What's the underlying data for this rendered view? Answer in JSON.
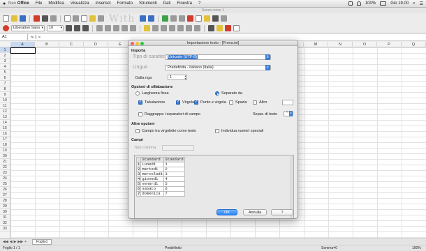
{
  "menubar": {
    "app_brand": "Office",
    "app_prefix": "Neo",
    "items": [
      "File",
      "Modifica",
      "Visualizza",
      "Inserisci",
      "Formato",
      "Strumenti",
      "Dati",
      "Finestra",
      "?"
    ],
    "clock": "Gio 19.00",
    "battery": "100%"
  },
  "window": {
    "title": "Senza nome 1"
  },
  "toolbar": {
    "watermark": "With",
    "font_name": "Liberation Sans",
    "font_size": "10"
  },
  "formula_bar": {
    "cell_ref": "A1",
    "fx_label": "fx  Σ  ="
  },
  "sheet": {
    "columns": [
      "A",
      "B",
      "C",
      "D",
      "E",
      "F",
      "G",
      "H",
      "I",
      "J",
      "K",
      "L",
      "M",
      "N",
      "O",
      "P",
      "Q"
    ],
    "rows": [
      "1",
      "2",
      "3",
      "4",
      "5",
      "6",
      "7",
      "8",
      "9",
      "10",
      "11",
      "12",
      "13",
      "14",
      "15",
      "16",
      "17",
      "18",
      "19",
      "20",
      "21",
      "22",
      "23",
      "24",
      "25",
      "26",
      "27",
      "28",
      "29",
      "30",
      "31",
      "32",
      "33"
    ],
    "tab_name": "Foglio1",
    "status": {
      "sheet": "Foglio 1 / 1",
      "style": "Predefinito",
      "sum": "Somma=0",
      "zoom": "100%"
    }
  },
  "dialog": {
    "title": "Importazione testo - [Prova.txt]",
    "import_section": "Importa",
    "charset_label": "Tipo di carattere",
    "charset_value": "Unicode (UTF-8)",
    "language_label": "Lingua",
    "language_value": "Predefinita - Italiano (Italia)",
    "from_row_label": "Dalla riga",
    "from_row_value": "1",
    "separator_section": "Opzioni di sillabazione",
    "fixed_width": "Larghezza fissa",
    "separated_by": "Separato da",
    "tab": "Tabulazione",
    "comma": "Virgola",
    "semicolon": "Punto e virgola",
    "space": "Spazio",
    "other": "Altro",
    "merge_delimiters": "Raggruppa i separatori di campo",
    "text_delimiter_label": "Separ. di testo",
    "text_delimiter_value": "\"",
    "other_section": "Altre opzioni",
    "quoted_as_text": "Campo tra virgolette come testo",
    "detect_special": "Individua numeri speciali",
    "fields_section": "Campi",
    "column_type_label": "Tipo colonna",
    "preview_headers": [
      "Standard",
      "Standard"
    ],
    "preview_rows": [
      [
        "1",
        "Lunedì",
        "1"
      ],
      [
        "2",
        "martedì",
        "2"
      ],
      [
        "3",
        "mercoledì",
        "3"
      ],
      [
        "4",
        "giovedì",
        "4"
      ],
      [
        "5",
        "venerdì",
        "5"
      ],
      [
        "6",
        "sabato",
        "6"
      ],
      [
        "7",
        "domenica",
        "7"
      ]
    ],
    "ok": "OK",
    "cancel": "Annulla",
    "help": "?"
  }
}
